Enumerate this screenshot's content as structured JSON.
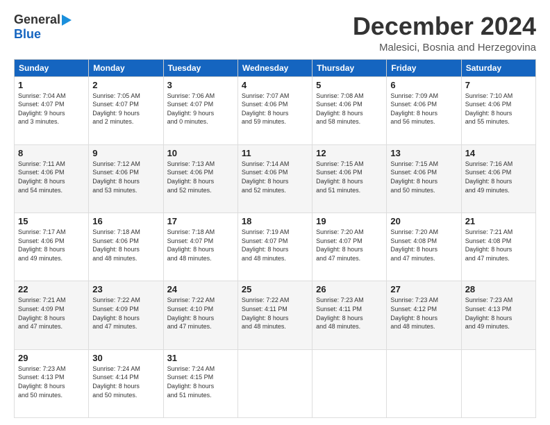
{
  "logo": {
    "general": "General",
    "blue": "Blue"
  },
  "title": "December 2024",
  "subtitle": "Malesici, Bosnia and Herzegovina",
  "weekdays": [
    "Sunday",
    "Monday",
    "Tuesday",
    "Wednesday",
    "Thursday",
    "Friday",
    "Saturday"
  ],
  "weeks": [
    [
      {
        "day": "1",
        "info": "Sunrise: 7:04 AM\nSunset: 4:07 PM\nDaylight: 9 hours\nand 3 minutes."
      },
      {
        "day": "2",
        "info": "Sunrise: 7:05 AM\nSunset: 4:07 PM\nDaylight: 9 hours\nand 2 minutes."
      },
      {
        "day": "3",
        "info": "Sunrise: 7:06 AM\nSunset: 4:07 PM\nDaylight: 9 hours\nand 0 minutes."
      },
      {
        "day": "4",
        "info": "Sunrise: 7:07 AM\nSunset: 4:06 PM\nDaylight: 8 hours\nand 59 minutes."
      },
      {
        "day": "5",
        "info": "Sunrise: 7:08 AM\nSunset: 4:06 PM\nDaylight: 8 hours\nand 58 minutes."
      },
      {
        "day": "6",
        "info": "Sunrise: 7:09 AM\nSunset: 4:06 PM\nDaylight: 8 hours\nand 56 minutes."
      },
      {
        "day": "7",
        "info": "Sunrise: 7:10 AM\nSunset: 4:06 PM\nDaylight: 8 hours\nand 55 minutes."
      }
    ],
    [
      {
        "day": "8",
        "info": "Sunrise: 7:11 AM\nSunset: 4:06 PM\nDaylight: 8 hours\nand 54 minutes."
      },
      {
        "day": "9",
        "info": "Sunrise: 7:12 AM\nSunset: 4:06 PM\nDaylight: 8 hours\nand 53 minutes."
      },
      {
        "day": "10",
        "info": "Sunrise: 7:13 AM\nSunset: 4:06 PM\nDaylight: 8 hours\nand 52 minutes."
      },
      {
        "day": "11",
        "info": "Sunrise: 7:14 AM\nSunset: 4:06 PM\nDaylight: 8 hours\nand 52 minutes."
      },
      {
        "day": "12",
        "info": "Sunrise: 7:15 AM\nSunset: 4:06 PM\nDaylight: 8 hours\nand 51 minutes."
      },
      {
        "day": "13",
        "info": "Sunrise: 7:15 AM\nSunset: 4:06 PM\nDaylight: 8 hours\nand 50 minutes."
      },
      {
        "day": "14",
        "info": "Sunrise: 7:16 AM\nSunset: 4:06 PM\nDaylight: 8 hours\nand 49 minutes."
      }
    ],
    [
      {
        "day": "15",
        "info": "Sunrise: 7:17 AM\nSunset: 4:06 PM\nDaylight: 8 hours\nand 49 minutes."
      },
      {
        "day": "16",
        "info": "Sunrise: 7:18 AM\nSunset: 4:06 PM\nDaylight: 8 hours\nand 48 minutes."
      },
      {
        "day": "17",
        "info": "Sunrise: 7:18 AM\nSunset: 4:07 PM\nDaylight: 8 hours\nand 48 minutes."
      },
      {
        "day": "18",
        "info": "Sunrise: 7:19 AM\nSunset: 4:07 PM\nDaylight: 8 hours\nand 48 minutes."
      },
      {
        "day": "19",
        "info": "Sunrise: 7:20 AM\nSunset: 4:07 PM\nDaylight: 8 hours\nand 47 minutes."
      },
      {
        "day": "20",
        "info": "Sunrise: 7:20 AM\nSunset: 4:08 PM\nDaylight: 8 hours\nand 47 minutes."
      },
      {
        "day": "21",
        "info": "Sunrise: 7:21 AM\nSunset: 4:08 PM\nDaylight: 8 hours\nand 47 minutes."
      }
    ],
    [
      {
        "day": "22",
        "info": "Sunrise: 7:21 AM\nSunset: 4:09 PM\nDaylight: 8 hours\nand 47 minutes."
      },
      {
        "day": "23",
        "info": "Sunrise: 7:22 AM\nSunset: 4:09 PM\nDaylight: 8 hours\nand 47 minutes."
      },
      {
        "day": "24",
        "info": "Sunrise: 7:22 AM\nSunset: 4:10 PM\nDaylight: 8 hours\nand 47 minutes."
      },
      {
        "day": "25",
        "info": "Sunrise: 7:22 AM\nSunset: 4:11 PM\nDaylight: 8 hours\nand 48 minutes."
      },
      {
        "day": "26",
        "info": "Sunrise: 7:23 AM\nSunset: 4:11 PM\nDaylight: 8 hours\nand 48 minutes."
      },
      {
        "day": "27",
        "info": "Sunrise: 7:23 AM\nSunset: 4:12 PM\nDaylight: 8 hours\nand 48 minutes."
      },
      {
        "day": "28",
        "info": "Sunrise: 7:23 AM\nSunset: 4:13 PM\nDaylight: 8 hours\nand 49 minutes."
      }
    ],
    [
      {
        "day": "29",
        "info": "Sunrise: 7:23 AM\nSunset: 4:13 PM\nDaylight: 8 hours\nand 50 minutes."
      },
      {
        "day": "30",
        "info": "Sunrise: 7:24 AM\nSunset: 4:14 PM\nDaylight: 8 hours\nand 50 minutes."
      },
      {
        "day": "31",
        "info": "Sunrise: 7:24 AM\nSunset: 4:15 PM\nDaylight: 8 hours\nand 51 minutes."
      },
      {
        "day": "",
        "info": ""
      },
      {
        "day": "",
        "info": ""
      },
      {
        "day": "",
        "info": ""
      },
      {
        "day": "",
        "info": ""
      }
    ]
  ]
}
